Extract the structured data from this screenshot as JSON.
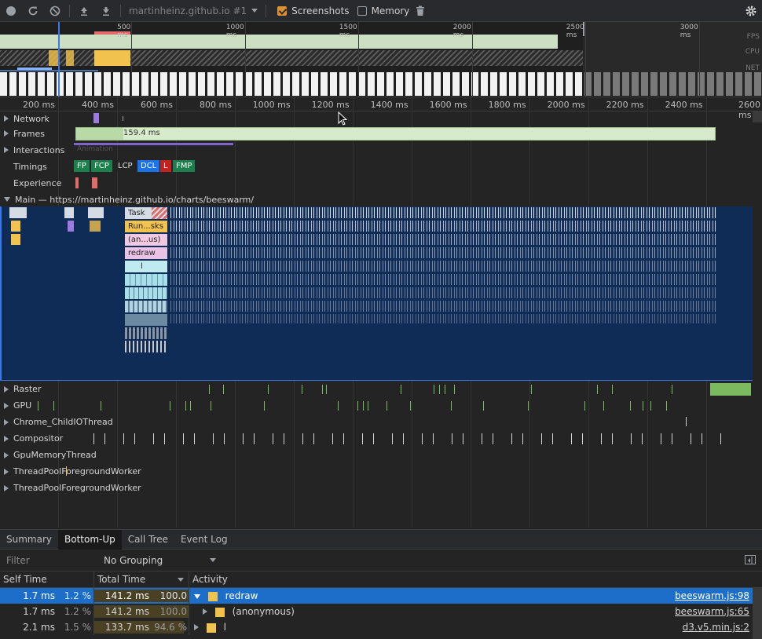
{
  "toolbar": {
    "profile_name": "martinheinz.github.io #1",
    "screenshots_label": "Screenshots",
    "screenshots_checked": true,
    "memory_label": "Memory",
    "memory_checked": false
  },
  "overview": {
    "ticks": [
      "500 ms",
      "1000 ms",
      "1500 ms",
      "2000 ms",
      "2500 ms",
      "3000 ms"
    ],
    "lanes": [
      "FPS",
      "CPU",
      "NET"
    ]
  },
  "ruler": {
    "ticks": [
      "200 ms",
      "400 ms",
      "600 ms",
      "800 ms",
      "1000 ms",
      "1200 ms",
      "1400 ms",
      "1600 ms",
      "1800 ms",
      "2000 ms",
      "2200 ms",
      "2400 ms",
      "2600 ms"
    ]
  },
  "tracks": {
    "network": "Network",
    "frames": "Frames",
    "frames_value": "159.4 ms",
    "interactions": "Interactions",
    "interactions_sub": "Animation",
    "timings": "Timings",
    "timing_chips": [
      {
        "label": "FP",
        "color": "#1e7f4e"
      },
      {
        "label": "FCP",
        "color": "#1e7f4e"
      },
      {
        "label": "LCP",
        "color": "#242424"
      },
      {
        "label": "DCL",
        "color": "#1a73e8"
      },
      {
        "label": "L",
        "color": "#c5221f"
      },
      {
        "label": "FMP",
        "color": "#1e7f4e"
      }
    ],
    "experience": "Experience",
    "main": "Main — https://martinheinz.github.io/charts/beeswarm/"
  },
  "flame": {
    "task": "Task",
    "run": "Run...sks",
    "anon": "(an...us)",
    "redraw": "redraw",
    "l": "l"
  },
  "threads": [
    "Raster",
    "GPU",
    "Chrome_ChildIOThread",
    "Compositor",
    "GpuMemoryThread",
    "ThreadPoolForegroundWorker",
    "ThreadPoolForegroundWorker"
  ],
  "bottom": {
    "tabs": [
      "Summary",
      "Bottom-Up",
      "Call Tree",
      "Event Log"
    ],
    "active_tab": "Bottom-Up",
    "filter_placeholder": "Filter",
    "grouping": "No Grouping",
    "columns": {
      "self": "Self Time",
      "total": "Total Time",
      "activity": "Activity"
    },
    "rows": [
      {
        "self_time": "1.7 ms",
        "self_pct": "1.2 %",
        "total_time": "141.2 ms",
        "total_pct": "100.0 %",
        "activity": "redraw",
        "source": "beeswarm.js:98",
        "expanded": true,
        "share": 1.0
      },
      {
        "self_time": "1.7 ms",
        "self_pct": "1.2 %",
        "total_time": "141.2 ms",
        "total_pct": "100.0 %",
        "activity": "(anonymous)",
        "source": "beeswarm.js:65",
        "expanded": false,
        "share": 1.0
      },
      {
        "self_time": "2.1 ms",
        "self_pct": "1.5 %",
        "total_time": "133.7 ms",
        "total_pct": "94.6 %",
        "activity": "l",
        "source": "d3.v5.min.js:2",
        "expanded": false,
        "share": 0.946
      }
    ]
  },
  "colors": {
    "accent": "#1d6ec9",
    "frames": "#d7eacb",
    "scripting": "#f2c24f",
    "main_bg": "#0f2c57",
    "raster": "#7cba5f"
  }
}
